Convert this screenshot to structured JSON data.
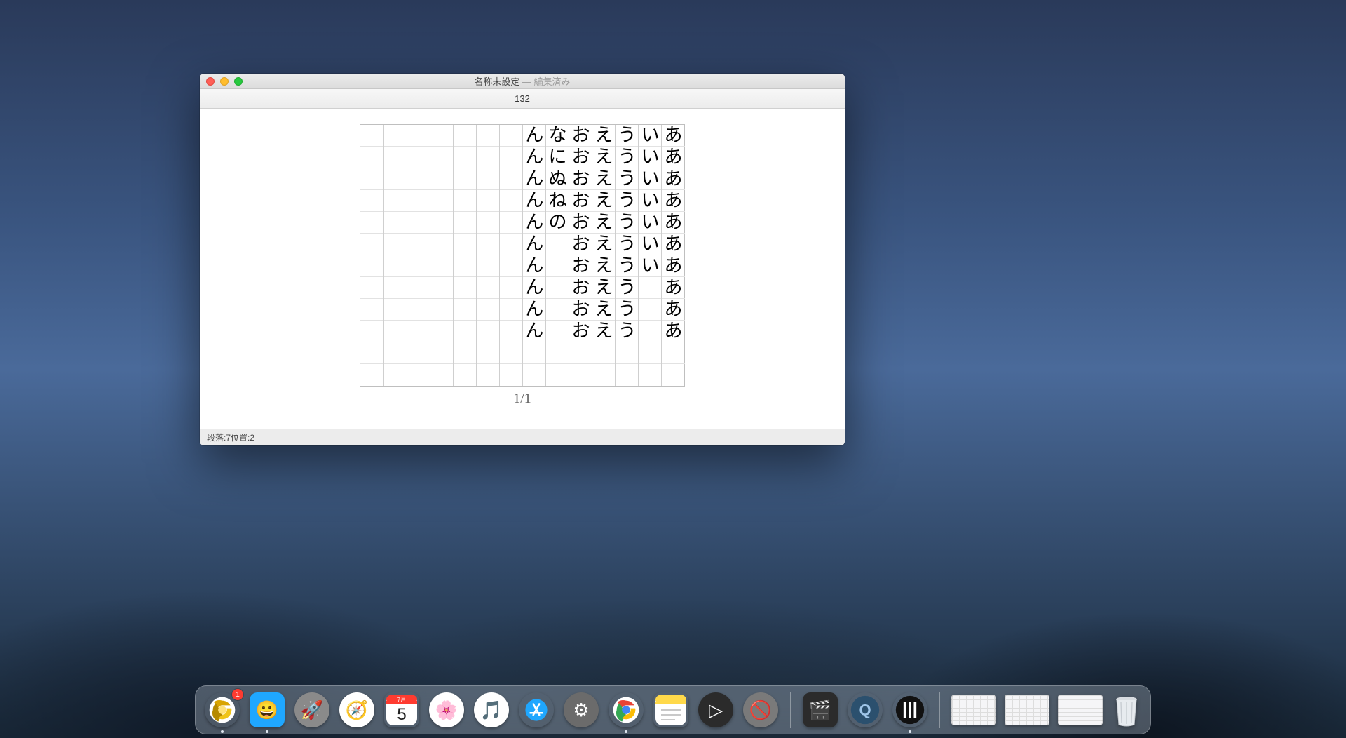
{
  "window": {
    "title_doc": "名称未設定",
    "title_sep": " — ",
    "title_status": "編集済み",
    "toolbar_value": "132",
    "page_indicator": "1/1",
    "status_paragraph_label": "段落: ",
    "status_paragraph_value": "7",
    "status_spacer": "  ",
    "status_position_label": "位置: ",
    "status_position_value": "2"
  },
  "manuscript": {
    "rows": 12,
    "columns": [
      "ああああああああああ",
      "いいいいいいい",
      "うううううううううう",
      "ええええええええええ",
      "おおおおおおおおおお",
      "なにぬねの",
      "んんんんんんんんんん",
      "",
      "",
      "",
      "",
      "",
      "",
      ""
    ]
  },
  "dock": {
    "apps": [
      {
        "name": "chrome-canary",
        "color": "#ffffff",
        "glyph_svg": "canary",
        "round": true,
        "running": true,
        "badge": "1"
      },
      {
        "name": "finder",
        "color": "#1fa7ff",
        "glyph": "😀",
        "running": true
      },
      {
        "name": "launchpad",
        "color": "#8a8a8a",
        "glyph": "🚀",
        "round": true
      },
      {
        "name": "safari",
        "color": "#ffffff",
        "glyph": "🧭",
        "round": true
      },
      {
        "name": "calendar",
        "color": "#ffffff",
        "glyph_svg": "calendar",
        "month": "7月",
        "day": "5"
      },
      {
        "name": "photos",
        "color": "#ffffff",
        "glyph": "🌸",
        "round": true
      },
      {
        "name": "itunes",
        "color": "#ffffff",
        "glyph": "🎵",
        "round": true
      },
      {
        "name": "app-store",
        "color": "#1fa7ff",
        "glyph_svg": "appstore",
        "round": true
      },
      {
        "name": "system-preferences",
        "color": "#6b6b6b",
        "glyph": "⚙",
        "round": true
      },
      {
        "name": "chrome",
        "color": "#ffffff",
        "glyph_svg": "chrome",
        "round": true,
        "running": true
      },
      {
        "name": "notes",
        "color": "#ffd94a",
        "glyph_svg": "notes"
      },
      {
        "name": "player",
        "color": "#2b2b2b",
        "glyph": "▷",
        "round": true
      },
      {
        "name": "screensaver",
        "color": "#7a7a7a",
        "glyph": "🚫",
        "round": true
      }
    ],
    "apps2": [
      {
        "name": "final-cut",
        "color": "#2b2b2b",
        "glyph": "🎬"
      },
      {
        "name": "quicktime",
        "color": "#2b506e",
        "glyph_svg": "qt",
        "round": true
      },
      {
        "name": "barcode-app",
        "color": "#111",
        "glyph_svg": "bars",
        "round": true,
        "running": true
      }
    ],
    "minimized_count": 3,
    "trash_name": "trash"
  }
}
